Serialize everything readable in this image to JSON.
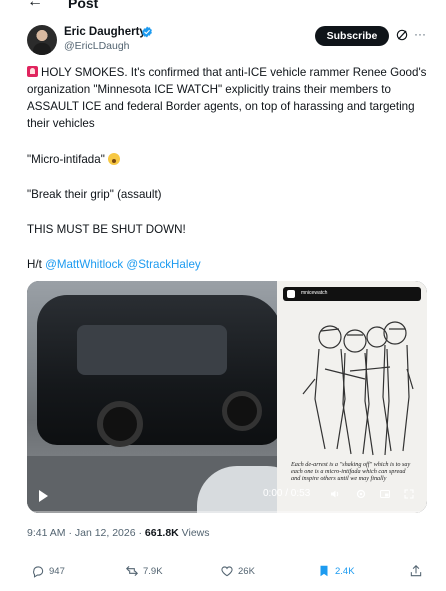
{
  "header": {
    "back_label": "←",
    "title": "Post"
  },
  "author": {
    "name": "Eric Daugherty",
    "handle": "@EricLDaugh",
    "subscribe_label": "Subscribe",
    "more_label": "···"
  },
  "post": {
    "paragraph_1": "HOLY SMOKES. It's confirmed that anti-ICE vehicle rammer Renee Good's organization \"Minnesota ICE WATCH\" explicitly trains their members to ASSAULT ICE and federal Border agents, on top of harassing and targeting their vehicles",
    "paragraph_2": "\"Micro-intifada\"",
    "paragraph_3": "\"Break their grip\" (assault)",
    "paragraph_4": "THIS MUST BE SHUT DOWN!",
    "ht_prefix": "H/t",
    "mention_1": "@MattWhitlock",
    "mention_2": "@StrackHaley"
  },
  "media": {
    "illustration_account": "mnicewatch",
    "illustration_caption": "Each de-arrest is a \"shaking off\" which is to say each one is a micro-intifada which can spread and inspire others until we may finally",
    "time_readout": "0:00 / 0:53"
  },
  "meta": {
    "time": "9:41 AM · Jan 12, 2026 · ",
    "views_count": "661.8K",
    "views_label": " Views"
  },
  "actions": {
    "replies": "947",
    "reposts": "7.9K",
    "likes": "26K",
    "bookmarks": "2.4K"
  },
  "colors": {
    "accent": "#1d9bf0",
    "text": "#0f1419",
    "muted": "#536471"
  }
}
